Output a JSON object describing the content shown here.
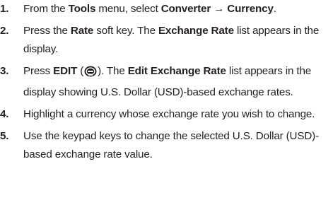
{
  "steps": [
    {
      "number": "1.",
      "parts": [
        "From the ",
        "Tools",
        " menu, select ",
        "Converter → Currency",
        "."
      ]
    },
    {
      "number": "2.",
      "parts": [
        "Press the ",
        "Rate",
        " soft key. The ",
        "Exchange Rate",
        " list appears in the display."
      ]
    },
    {
      "number": "3.",
      "parts": [
        "Press ",
        "EDIT",
        " (",
        "). The ",
        "Edit Exchange Rate",
        " list appears in the display showing U.S. Dollar (USD)-based exchange rates."
      ],
      "key_icon": "ok-key-icon"
    },
    {
      "number": "4.",
      "parts": [
        "Highlight a currency whose exchange rate you wish to change."
      ]
    },
    {
      "number": "5.",
      "parts": [
        "Use the keypad keys to change the selected U.S. Dollar (USD)-based exchange rate value."
      ]
    }
  ]
}
